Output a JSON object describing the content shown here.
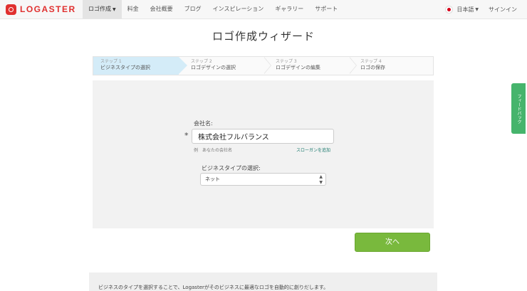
{
  "brand": {
    "name": "LOGASTER"
  },
  "nav": {
    "items": [
      {
        "label": "ロゴ作成",
        "active": true,
        "dropdown": true
      },
      {
        "label": "料金"
      },
      {
        "label": "会社概要"
      },
      {
        "label": "ブログ"
      },
      {
        "label": "インスピレーション"
      },
      {
        "label": "ギャラリー"
      },
      {
        "label": "サポート"
      }
    ],
    "language": "日本語",
    "signin": "サインイン"
  },
  "page_title": "ロゴ作成ウィザード",
  "steps": [
    {
      "num": "ステップ 1",
      "label": "ビジネスタイプの選択",
      "active": true
    },
    {
      "num": "ステップ 2",
      "label": "ロゴデザインの選択"
    },
    {
      "num": "ステップ 3",
      "label": "ロゴデザインの編集"
    },
    {
      "num": "ステップ 4",
      "label": "ロゴの保存"
    }
  ],
  "form": {
    "company_label": "会社名:",
    "asterisk": "*",
    "company_value": "株式会社フルバランス",
    "example": "例　あなたの会社名",
    "slogan_link": "スローガンを追加",
    "biz_label": "ビジネスタイプの選択:",
    "biz_selected": "ネット"
  },
  "next_button": "次へ",
  "info_text": "ビジネスのタイプを選択することで、Logasterがそのビジネスに最適なロゴを自動的に創りだします。",
  "feedback_tab": "フィードバック",
  "colors": {
    "brand": "#e0302f",
    "accent_green": "#79b93d",
    "active_step": "#d4ecf8",
    "feedback": "#46b46c"
  }
}
